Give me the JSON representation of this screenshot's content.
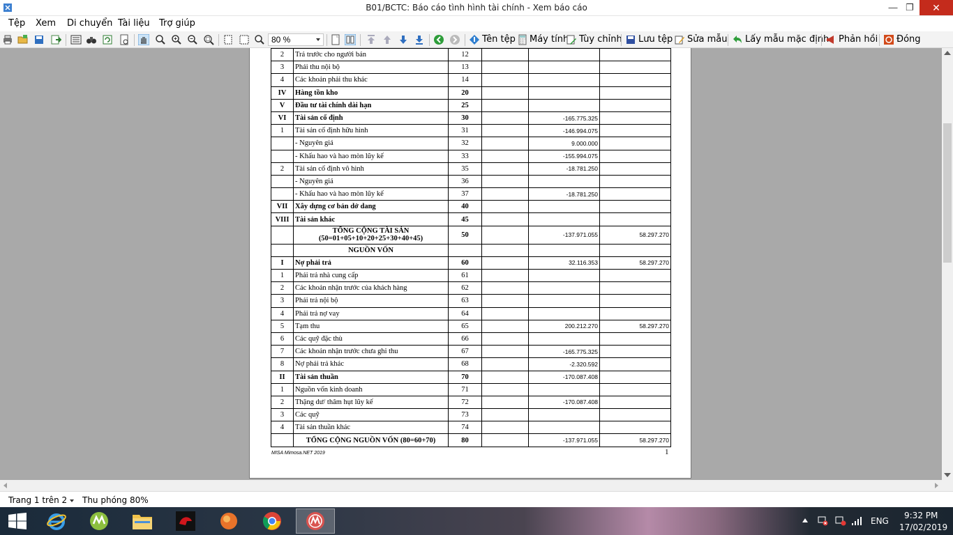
{
  "window": {
    "title": "B01/BCTC: Báo cáo tình hình tài chính - Xem báo cáo"
  },
  "menu": [
    "Tệp",
    "Xem",
    "Di chuyển",
    "Tài liệu",
    "Trợ giúp"
  ],
  "toolbar": {
    "zoom_value": "80 %",
    "buttons": {
      "rename": "Tên tệp",
      "calculator": "Máy tính",
      "customize": "Tùy chỉnh",
      "save_template": "Lưu tệp",
      "edit_template": "Sửa mẫu",
      "default_template": "Lấy mẫu mặc định",
      "feedback": "Phản hồi",
      "close": "Đóng"
    }
  },
  "report": {
    "rows": [
      {
        "stt": "2",
        "name": "Trả trước cho người bán",
        "code": "12",
        "current": "",
        "previous": "",
        "bold": false
      },
      {
        "stt": "3",
        "name": "Phải thu nội bộ",
        "code": "13",
        "current": "",
        "previous": "",
        "bold": false
      },
      {
        "stt": "4",
        "name": "Các khoản phải thu khác",
        "code": "14",
        "current": "",
        "previous": "",
        "bold": false
      },
      {
        "stt": "IV",
        "name": "Hàng tồn kho",
        "code": "20",
        "current": "",
        "previous": "",
        "bold": true
      },
      {
        "stt": "V",
        "name": "Đầu tư tài chính dài hạn",
        "code": "25",
        "current": "",
        "previous": "",
        "bold": true
      },
      {
        "stt": "VI",
        "name": "Tài sản cố định",
        "code": "30",
        "current": "-165.775.325",
        "previous": "",
        "bold": true
      },
      {
        "stt": "1",
        "name": "Tài sản cố định hữu hình",
        "code": "31",
        "current": "-146.994.075",
        "previous": "",
        "bold": false
      },
      {
        "stt": "",
        "name": "- Nguyên giá",
        "code": "32",
        "current": "9.000.000",
        "previous": "",
        "bold": false
      },
      {
        "stt": "",
        "name": "- Khấu hao và hao mòn lũy kế",
        "code": "33",
        "current": "-155.994.075",
        "previous": "",
        "bold": false
      },
      {
        "stt": "2",
        "name": "Tài sản cố định vô hình",
        "code": "35",
        "current": "-18.781.250",
        "previous": "",
        "bold": false
      },
      {
        "stt": "",
        "name": "- Nguyên giá",
        "code": "36",
        "current": "",
        "previous": "",
        "bold": false
      },
      {
        "stt": "",
        "name": "- Khấu hao và hao mòn lũy kế",
        "code": "37",
        "current": "-18.781.250",
        "previous": "",
        "bold": false
      },
      {
        "stt": "VII",
        "name": "Xây dựng cơ bản dở dang",
        "code": "40",
        "current": "",
        "previous": "",
        "bold": true
      },
      {
        "stt": "VIII",
        "name": "Tài sản khác",
        "code": "45",
        "current": "",
        "previous": "",
        "bold": true
      }
    ],
    "total_assets": {
      "line1": "TỔNG CỘNG TÀI SẢN",
      "line2": "(50=01+05+10+20+25+30+40+45)",
      "code": "50",
      "current": "-137.971.055",
      "previous": "58.297.270"
    },
    "capital_header": "NGUỒN VỐN",
    "rows2": [
      {
        "stt": "I",
        "name": "Nợ phải trả",
        "code": "60",
        "current": "32.116.353",
        "previous": "58.297.270",
        "bold": true
      },
      {
        "stt": "1",
        "name": "Phải trả nhà cung cấp",
        "code": "61",
        "current": "",
        "previous": "",
        "bold": false
      },
      {
        "stt": "2",
        "name": "Các khoản nhận trước của khách hàng",
        "code": "62",
        "current": "",
        "previous": "",
        "bold": false
      },
      {
        "stt": "3",
        "name": "Phải trả nội bộ",
        "code": "63",
        "current": "",
        "previous": "",
        "bold": false
      },
      {
        "stt": "4",
        "name": "Phải trả nợ vay",
        "code": "64",
        "current": "",
        "previous": "",
        "bold": false
      },
      {
        "stt": "5",
        "name": "Tạm thu",
        "code": "65",
        "current": "200.212.270",
        "previous": "58.297.270",
        "bold": false
      },
      {
        "stt": "6",
        "name": "Các quỹ đặc thù",
        "code": "66",
        "current": "",
        "previous": "",
        "bold": false
      },
      {
        "stt": "7",
        "name": "Các khoản nhận trước chưa ghi thu",
        "code": "67",
        "current": "-165.775.325",
        "previous": "",
        "bold": false
      },
      {
        "stt": "8",
        "name": "Nợ phải trả khác",
        "code": "68",
        "current": "-2.320.592",
        "previous": "",
        "bold": false
      },
      {
        "stt": "II",
        "name": "Tài sản thuần",
        "code": "70",
        "current": "-170.087.408",
        "previous": "",
        "bold": true
      },
      {
        "stt": "1",
        "name": "Nguồn vốn kinh doanh",
        "code": "71",
        "current": "",
        "previous": "",
        "bold": false
      },
      {
        "stt": "2",
        "name": "Thặng dư/ thâm hụt lũy kế",
        "code": "72",
        "current": "-170.087.408",
        "previous": "",
        "bold": false
      },
      {
        "stt": "3",
        "name": "Các quỹ",
        "code": "73",
        "current": "",
        "previous": "",
        "bold": false
      },
      {
        "stt": "4",
        "name": "Tài sản thuần khác",
        "code": "74",
        "current": "",
        "previous": "",
        "bold": false
      }
    ],
    "total_capital": {
      "label": "TỔNG CỘNG NGUỒN VỐN (80=60+70)",
      "code": "80",
      "current": "-137.971.055",
      "previous": "58.297.270"
    },
    "footer_left": "MISA Mimosa.NET 2019",
    "page_number": "1"
  },
  "status": {
    "page": "Trang 1 trên 2",
    "zoom": "Thu phóng 80%"
  },
  "tray": {
    "language": "ENG",
    "time": "9:32 PM",
    "date": "17/02/2019"
  }
}
